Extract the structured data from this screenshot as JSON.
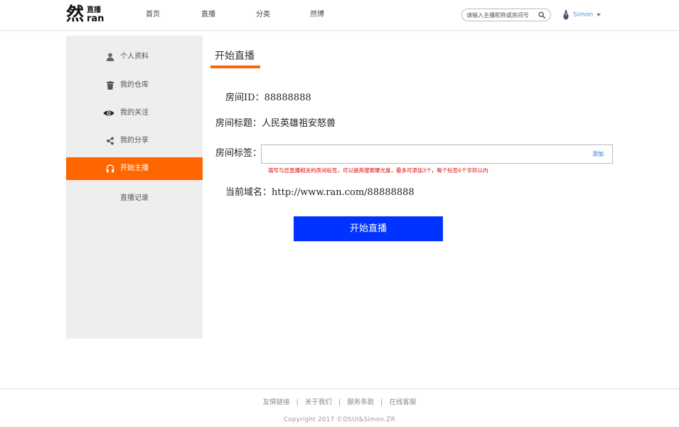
{
  "header": {
    "logo": {
      "big": "然",
      "small_top": "直播",
      "small_bottom": "ran"
    },
    "nav": [
      "首页",
      "直播",
      "分类",
      "然博"
    ],
    "search": {
      "placeholder": "请输入主播昵称或房间号",
      "value": ""
    },
    "user": {
      "name": "Simon"
    }
  },
  "sidebar": {
    "items": [
      {
        "label": "个人资料",
        "icon": "user-icon"
      },
      {
        "label": "我的仓库",
        "icon": "trash-icon"
      },
      {
        "label": "我的关注",
        "icon": "eye-icon"
      },
      {
        "label": "我的分享",
        "icon": "share-icon"
      },
      {
        "label": "开始主播",
        "icon": "headphones-icon",
        "active": true
      },
      {
        "label": "直播记录",
        "icon": ""
      }
    ]
  },
  "main": {
    "title": "开始直播",
    "room_id_label": "房间ID：",
    "room_id_value": "88888888",
    "room_title_label": "房间标题：",
    "room_title_value": "人民英雄祖安怒兽",
    "room_tags_label": "房间标签：",
    "tag_input": {
      "value": "",
      "placeholder": ""
    },
    "add_label": "添加",
    "hint": "填写与您直播相关的房间标签，可以提高搜索曝光度，最多可添加3个，每个标签6个字符以内",
    "domain_label": "当前域名：",
    "domain_value": "http://www.ran.com/88888888",
    "start_button": "开始直播"
  },
  "footer": {
    "links": [
      "友情链接",
      "关于我们",
      "服务条款",
      "在线客服"
    ],
    "separator": "|",
    "copyright": "Copyright 2017 ©DSUI&Simon.ZR"
  },
  "colors": {
    "accent": "#ff6600",
    "button": "#0033ff",
    "hint": "#e00000",
    "user": "#4aa3df"
  }
}
